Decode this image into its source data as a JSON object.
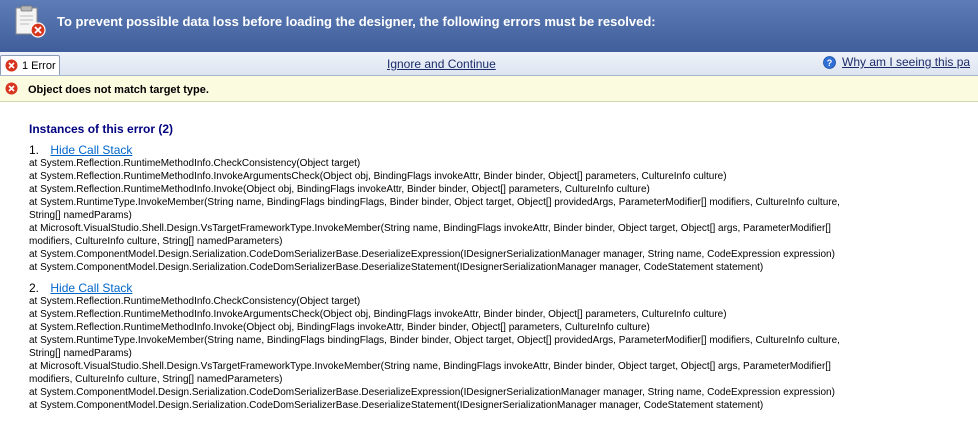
{
  "banner": {
    "message": "To prevent possible data loss before loading the designer, the following errors must be resolved:",
    "icon": "clipboard-error-icon"
  },
  "tabs": {
    "error_tab_label": "1 Error",
    "ignore_link": "Ignore and Continue",
    "why_link": "Why am I seeing this pa",
    "help_icon": "help-icon"
  },
  "error": {
    "message": "Object does not match target type.",
    "instances_title": "Instances of this error (2)"
  },
  "instances": [
    {
      "number": "1.",
      "toggle_label": "Hide Call Stack",
      "lines": [
        "at System.Reflection.RuntimeMethodInfo.CheckConsistency(Object target)",
        "at System.Reflection.RuntimeMethodInfo.InvokeArgumentsCheck(Object obj, BindingFlags invokeAttr, Binder binder, Object[] parameters, CultureInfo culture)",
        "at System.Reflection.RuntimeMethodInfo.Invoke(Object obj, BindingFlags invokeAttr, Binder binder, Object[] parameters, CultureInfo culture)",
        "at System.RuntimeType.InvokeMember(String name, BindingFlags bindingFlags, Binder binder, Object target, Object[] providedArgs, ParameterModifier[] modifiers, CultureInfo culture,",
        "String[] namedParams)",
        "at Microsoft.VisualStudio.Shell.Design.VsTargetFrameworkType.InvokeMember(String name, BindingFlags invokeAttr, Binder binder, Object target, Object[] args, ParameterModifier[]",
        "modifiers, CultureInfo culture, String[] namedParameters)",
        "at System.ComponentModel.Design.Serialization.CodeDomSerializerBase.DeserializeExpression(IDesignerSerializationManager manager, String name, CodeExpression expression)",
        "at System.ComponentModel.Design.Serialization.CodeDomSerializerBase.DeserializeStatement(IDesignerSerializationManager manager, CodeStatement statement)"
      ]
    },
    {
      "number": "2.",
      "toggle_label": "Hide Call Stack",
      "lines": [
        "at System.Reflection.RuntimeMethodInfo.CheckConsistency(Object target)",
        "at System.Reflection.RuntimeMethodInfo.InvokeArgumentsCheck(Object obj, BindingFlags invokeAttr, Binder binder, Object[] parameters, CultureInfo culture)",
        "at System.Reflection.RuntimeMethodInfo.Invoke(Object obj, BindingFlags invokeAttr, Binder binder, Object[] parameters, CultureInfo culture)",
        "at System.RuntimeType.InvokeMember(String name, BindingFlags bindingFlags, Binder binder, Object target, Object[] providedArgs, ParameterModifier[] modifiers, CultureInfo culture,",
        "String[] namedParams)",
        "at Microsoft.VisualStudio.Shell.Design.VsTargetFrameworkType.InvokeMember(String name, BindingFlags invokeAttr, Binder binder, Object target, Object[] args, ParameterModifier[]",
        "modifiers, CultureInfo culture, String[] namedParameters)",
        "at System.ComponentModel.Design.Serialization.CodeDomSerializerBase.DeserializeExpression(IDesignerSerializationManager manager, String name, CodeExpression expression)",
        "at System.ComponentModel.Design.Serialization.CodeDomSerializerBase.DeserializeStatement(IDesignerSerializationManager manager, CodeStatement statement)"
      ]
    }
  ]
}
